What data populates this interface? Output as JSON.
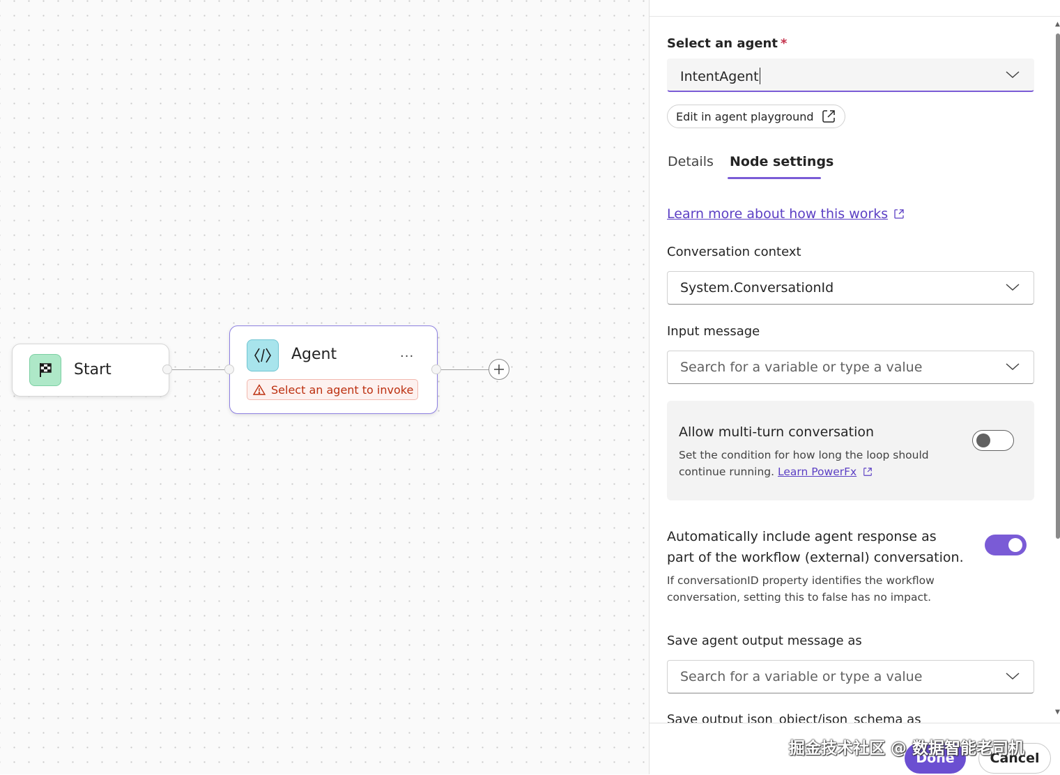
{
  "canvas": {
    "start_node": {
      "label": "Start",
      "icon": "checkered-flag-icon"
    },
    "agent_node": {
      "label": "Agent",
      "icon": "code-brackets-icon",
      "more": "...",
      "warning": "Select an agent to invoke"
    }
  },
  "panel": {
    "select_agent": {
      "label": "Select an agent",
      "required_mark": "*",
      "value": "IntentAgent"
    },
    "edit_playground_label": "Edit in agent playground",
    "tabs": [
      {
        "label": "Details",
        "active": false
      },
      {
        "label": "Node settings",
        "active": true
      }
    ],
    "learn_more": "Learn more about how this works",
    "conversation_context": {
      "label": "Conversation context",
      "value": "System.ConversationId"
    },
    "input_message": {
      "label": "Input message",
      "placeholder": "Search for a variable or type a value"
    },
    "multi_turn": {
      "title": "Allow multi-turn conversation",
      "desc": "Set the condition for how long the loop should continue running.",
      "link": "Learn PowerFx",
      "enabled": false
    },
    "auto_include": {
      "title": "Automatically include agent response as part of the workflow (external) conversation.",
      "desc": "If conversationID property identifies the workflow conversation, setting this to false has no impact.",
      "enabled": true
    },
    "save_output": {
      "label": "Save agent output message as",
      "placeholder": "Search for a variable or type a value"
    },
    "save_json_label": "Save output json_object/json_schema as",
    "footer": {
      "done": "Done",
      "cancel": "Cancel"
    },
    "watermark": "掘金技术社区 @ 数据智能老司机"
  },
  "colors": {
    "accent": "#7a5bd6",
    "warning_text": "#bc2f0f",
    "start_icon_bg": "#aee8c8",
    "agent_icon_bg": "#a8e4ec"
  }
}
